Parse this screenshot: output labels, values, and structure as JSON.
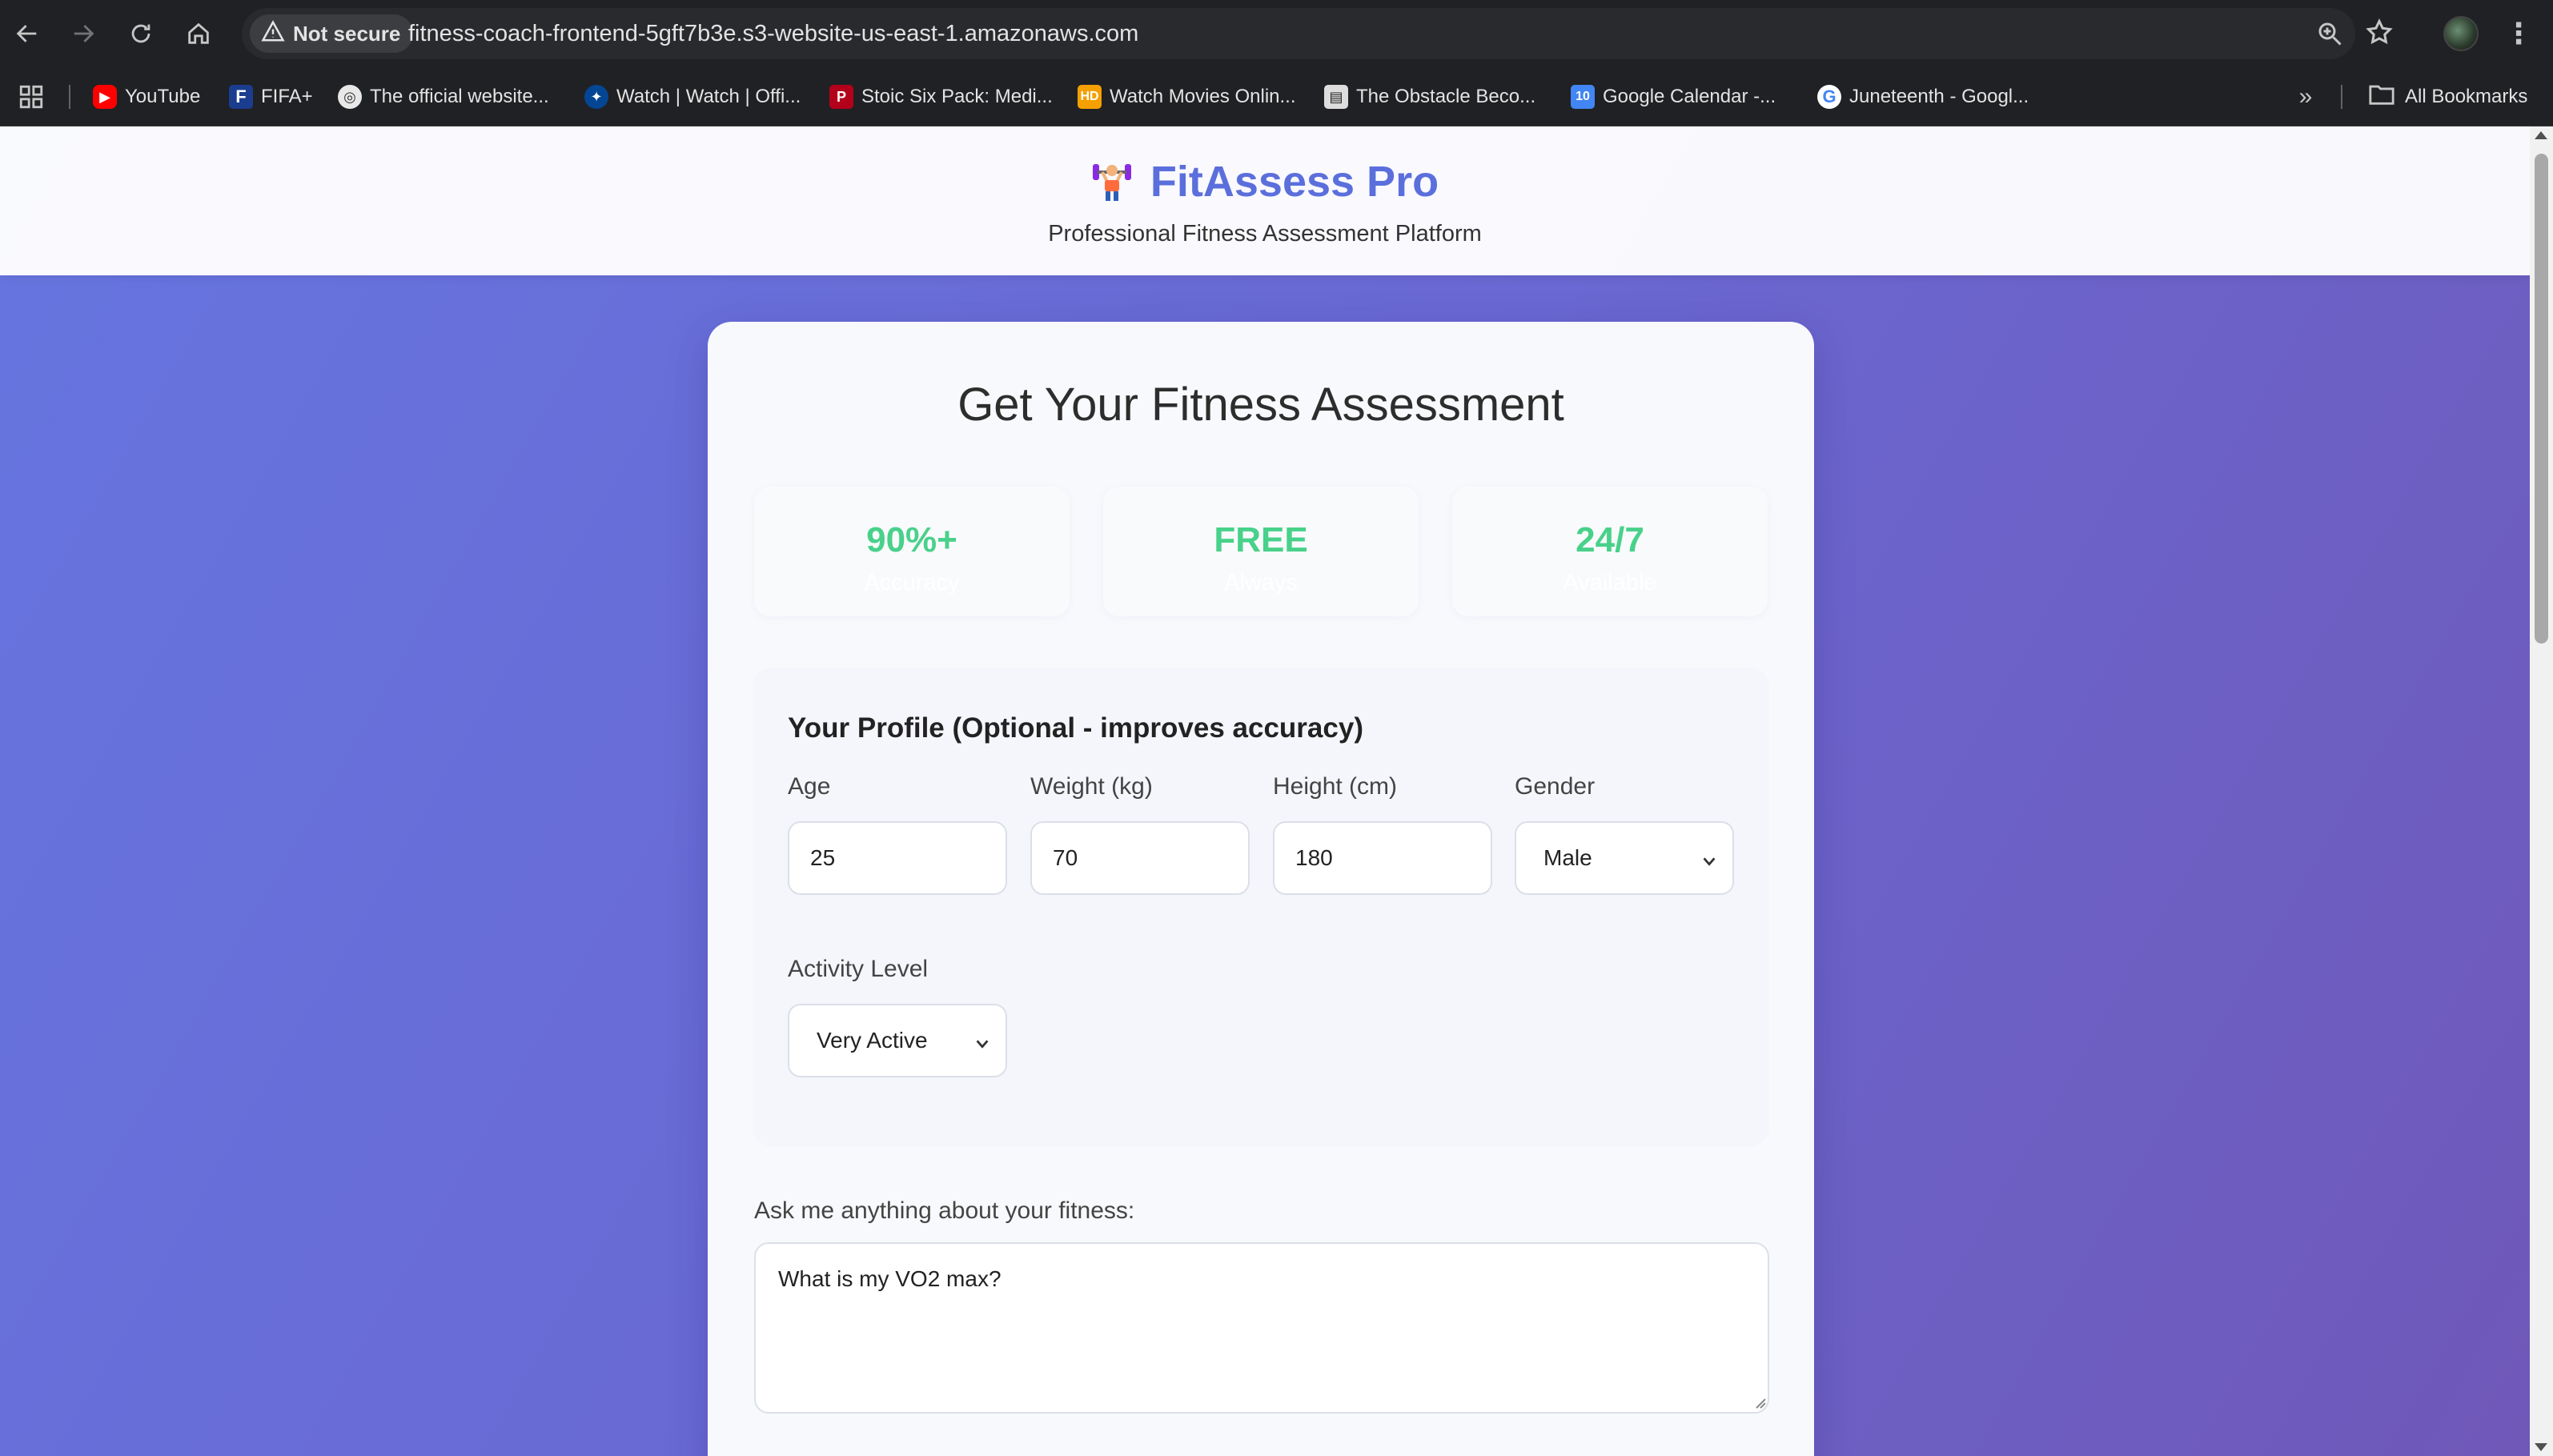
{
  "browser": {
    "security_chip": "Not secure",
    "url": "fitness-coach-frontend-5gft7b3e.s3-website-us-east-1.amazonaws.com",
    "icons": [
      "back-icon",
      "forward-icon",
      "reload-icon",
      "home-icon",
      "warning-icon",
      "zoom-icon",
      "star-icon",
      "menu-icon"
    ],
    "bookmarks": [
      {
        "label": "YouTube",
        "icon": "youtube-icon",
        "color": "#ff0000"
      },
      {
        "label": "FIFA+",
        "icon": "fifa-icon",
        "color": "#1a3d8f"
      },
      {
        "label": "The official website...",
        "icon": "globe-icon",
        "color": "#e8e8e8"
      },
      {
        "label": "Watch | Watch | Offi...",
        "icon": "chelsea-icon",
        "color": "#034694"
      },
      {
        "label": "Stoic Six Pack: Medi...",
        "icon": "stoic-icon",
        "color": "#b3001b"
      },
      {
        "label": "Watch Movies Onlin...",
        "icon": "hd-icon",
        "color": "#f5a000"
      },
      {
        "label": "The Obstacle Beco...",
        "icon": "book-icon",
        "color": "#dddddd"
      },
      {
        "label": "Google Calendar -...",
        "icon": "calendar-icon",
        "color": "#4285f4"
      },
      {
        "label": "Juneteenth - Googl...",
        "icon": "google-icon",
        "color": "#ffffff"
      }
    ],
    "all_bookmarks": "All Bookmarks"
  },
  "header": {
    "title": "FitAssess Pro",
    "subtitle": "Professional Fitness Assessment Platform",
    "logo_icon": "weightlifter-icon",
    "title_color": "#5b6fdc"
  },
  "card": {
    "title": "Get Your Fitness Assessment",
    "stats": [
      {
        "value": "90%+",
        "label": "Accuracy"
      },
      {
        "value": "FREE",
        "label": "Always"
      },
      {
        "value": "24/7",
        "label": "Available"
      }
    ],
    "stat_color": "#48d18a"
  },
  "profile": {
    "title": "Your Profile (Optional - improves accuracy)",
    "age": {
      "label": "Age",
      "value": "25"
    },
    "weight": {
      "label": "Weight (kg)",
      "value": "70"
    },
    "height": {
      "label": "Height (cm)",
      "value": "180"
    },
    "gender": {
      "label": "Gender",
      "value": "Male"
    },
    "activity": {
      "label": "Activity Level",
      "value": "Very Active"
    }
  },
  "question": {
    "label": "Ask me anything about your fitness:",
    "value": "What is my VO2 max?"
  },
  "colors": {
    "gradient_start": "#6675e0",
    "gradient_end": "#6f58b8"
  }
}
